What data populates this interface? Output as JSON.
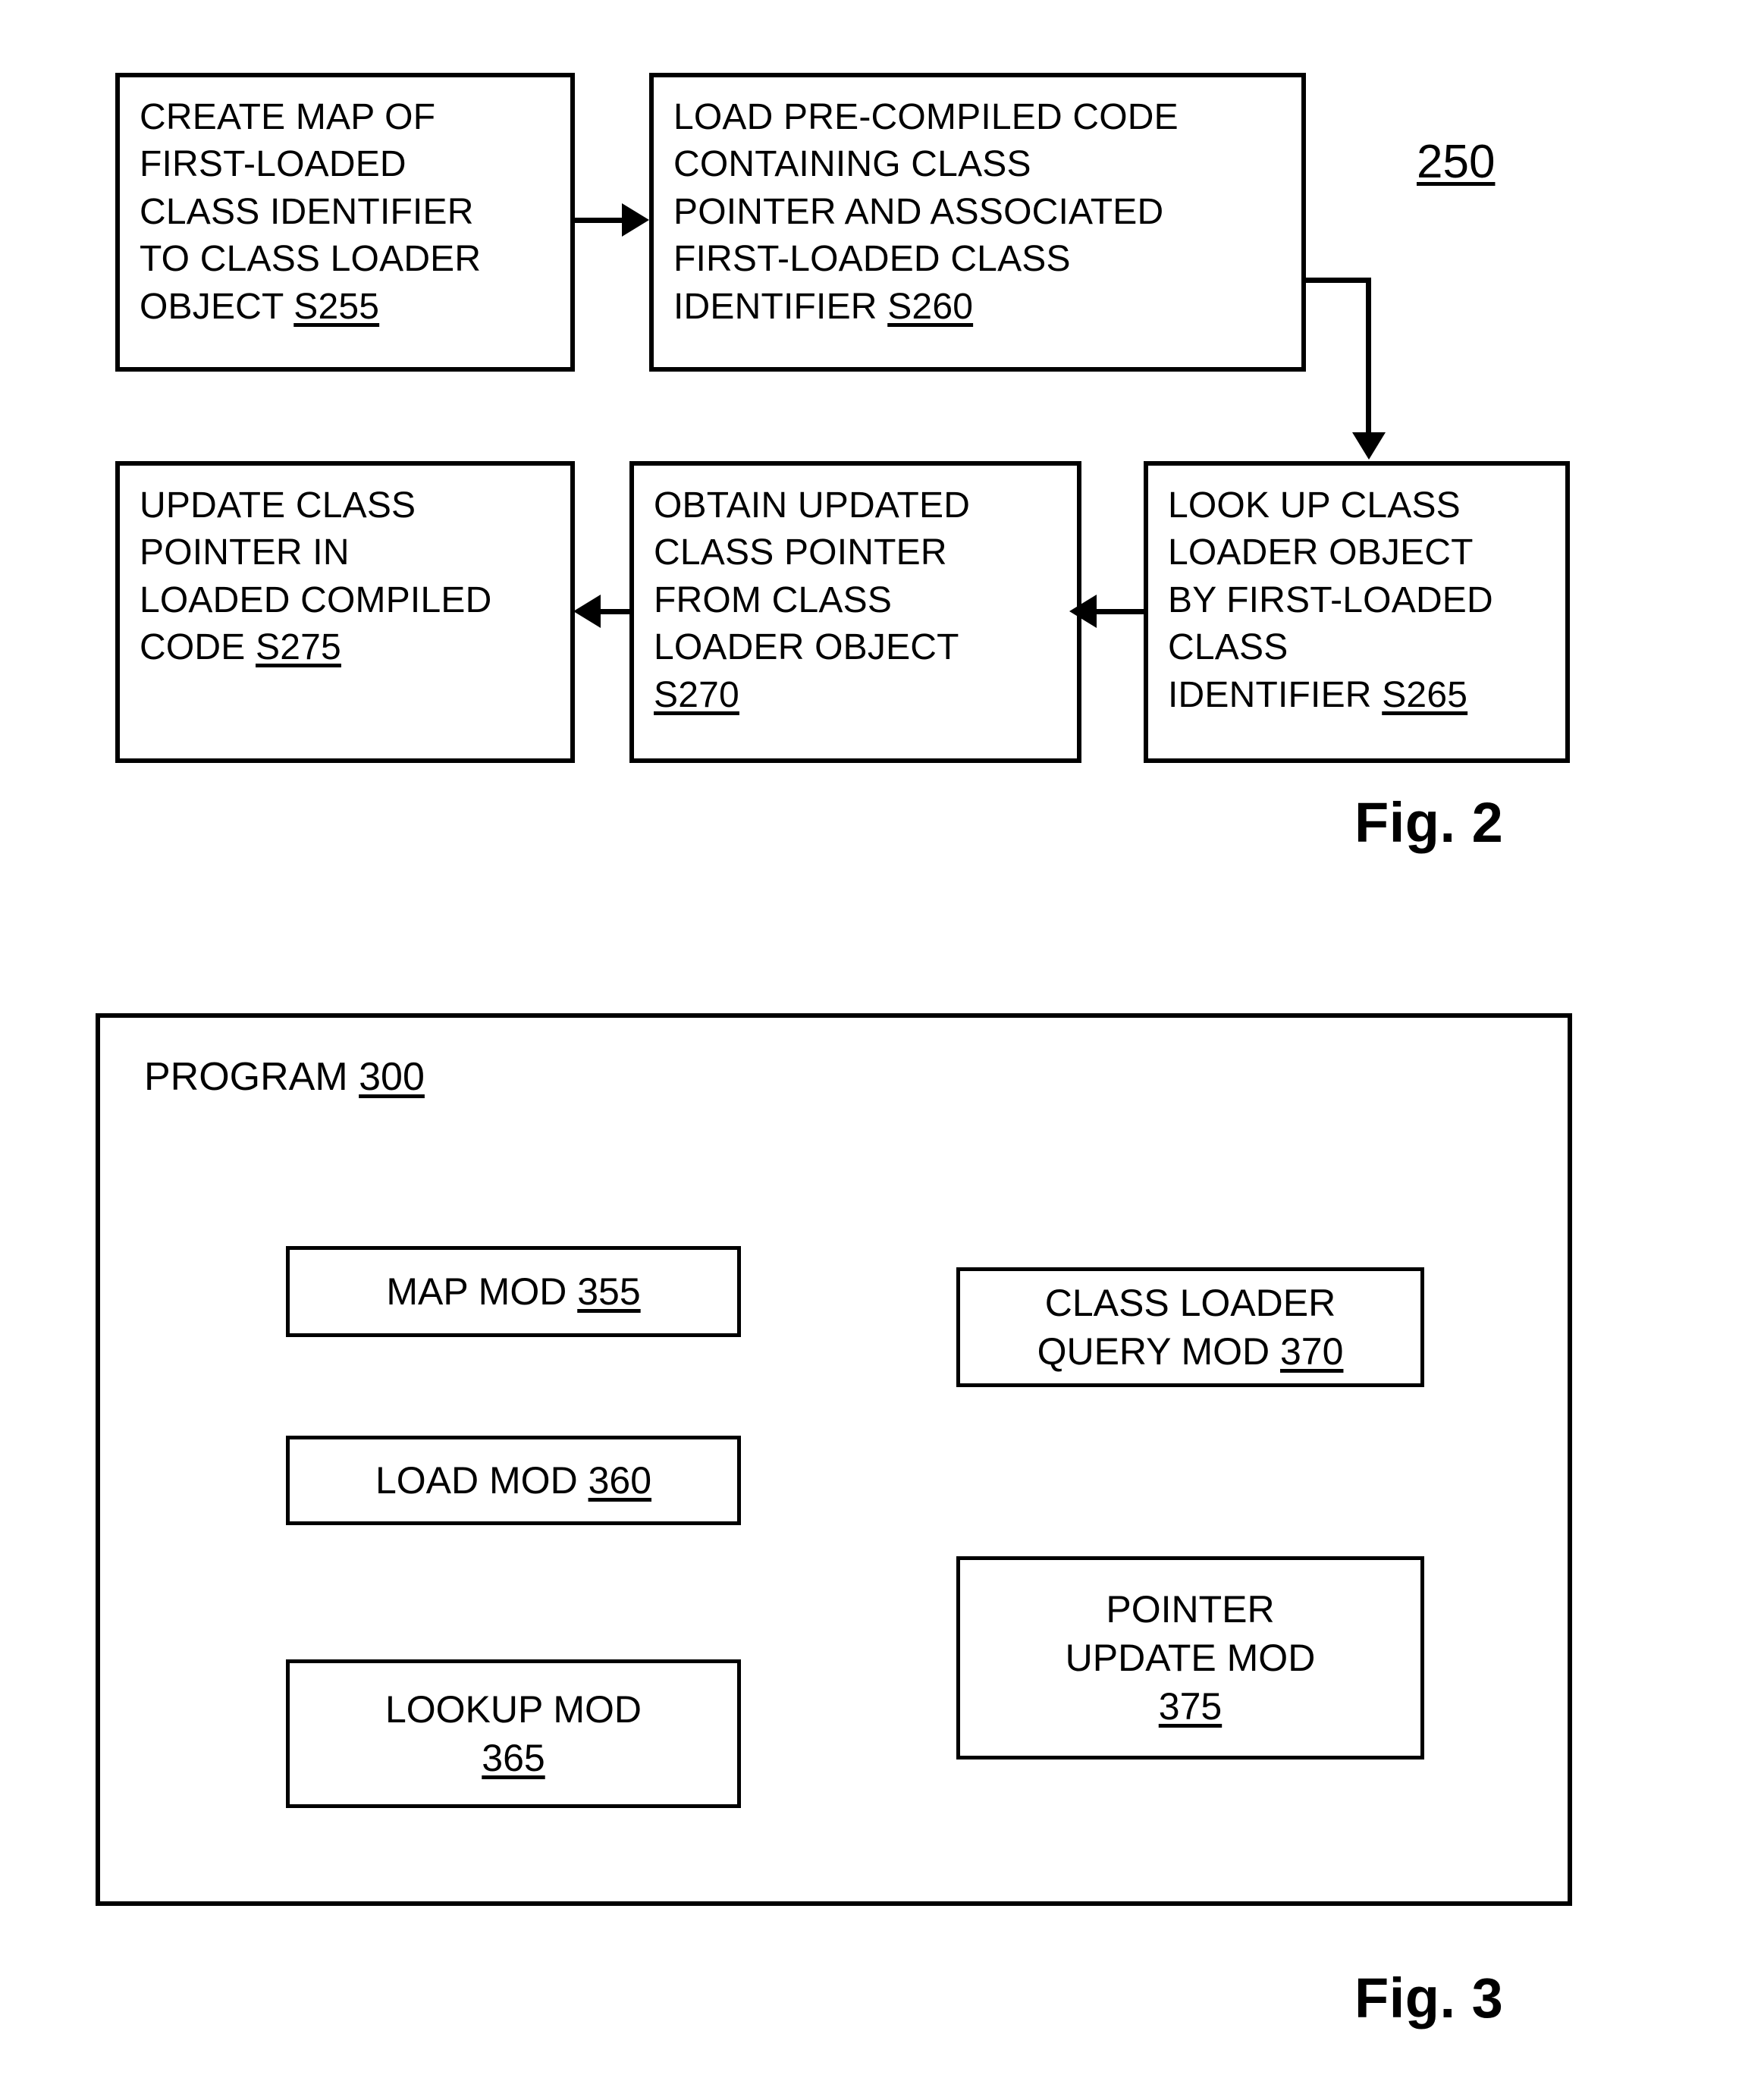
{
  "figure2": {
    "reference_label": "250",
    "caption": "Fig. 2",
    "steps": [
      {
        "id": "S255",
        "text": "CREATE MAP OF\nFIRST-LOADED\nCLASS IDENTIFIER\nTO CLASS LOADER\nOBJECT ",
        "ref": "S255"
      },
      {
        "id": "S260",
        "text": "LOAD PRE-COMPILED CODE\nCONTAINING CLASS\nPOINTER AND ASSOCIATED\nFIRST-LOADED CLASS\nIDENTIFIER ",
        "ref": "S260"
      },
      {
        "id": "S265",
        "text": "LOOK UP CLASS\nLOADER OBJECT\nBY FIRST-LOADED\nCLASS\nIDENTIFIER ",
        "ref": "S265"
      },
      {
        "id": "S270",
        "text": "OBTAIN UPDATED\nCLASS POINTER\nFROM CLASS\nLOADER OBJECT\n",
        "ref": "S270"
      },
      {
        "id": "S275",
        "text": "UPDATE CLASS\nPOINTER IN\nLOADED COMPILED\nCODE ",
        "ref": "S275"
      }
    ]
  },
  "figure3": {
    "caption": "Fig. 3",
    "program_label": "PROGRAM ",
    "program_ref": "300",
    "modules": [
      {
        "id": "mod-355",
        "text": "MAP MOD ",
        "ref": "355"
      },
      {
        "id": "mod-360",
        "text": "LOAD MOD ",
        "ref": "360"
      },
      {
        "id": "mod-365",
        "text": "LOOKUP MOD\n",
        "ref": "365"
      },
      {
        "id": "mod-370",
        "text": "CLASS LOADER\nQUERY MOD ",
        "ref": "370"
      },
      {
        "id": "mod-375",
        "text": "POINTER\nUPDATE MOD\n",
        "ref": "375"
      }
    ]
  },
  "colors": {
    "ink": "#000000",
    "paper": "#ffffff"
  }
}
